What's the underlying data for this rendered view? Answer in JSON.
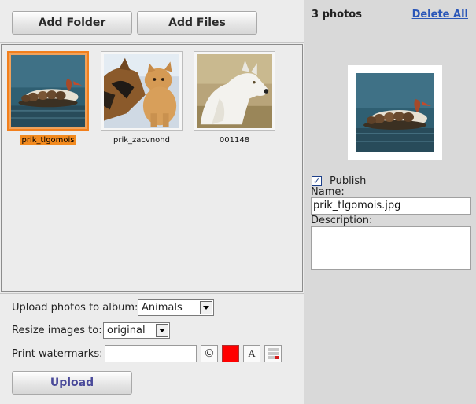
{
  "toolbar": {
    "add_folder_label": "Add Folder",
    "add_files_label": "Add Files"
  },
  "gallery": {
    "items": [
      {
        "caption": "prik_tlgomois",
        "selected": true,
        "image": "ducks-on-water"
      },
      {
        "caption": "prik_zacvnohd",
        "selected": false,
        "image": "dog-and-cat"
      },
      {
        "caption": "001148",
        "selected": false,
        "image": "white-wolf"
      }
    ],
    "selection_color": "#f27f1c"
  },
  "options": {
    "album_label": "Upload photos to album:",
    "album_value": "Animals",
    "resize_label": "Resize images to:",
    "resize_value": "original",
    "watermark_label": "Print watermarks:",
    "watermark_value": "",
    "watermark_color": "#ff0000",
    "watermark_icons": [
      "copyright-icon",
      "color-swatch",
      "text-style-icon",
      "position-grid-icon"
    ]
  },
  "upload_label": "Upload",
  "sidebar": {
    "count_text": "3 photos",
    "delete_all_label": "Delete All",
    "preview_image": "ducks-on-water",
    "publish_label": "Publish",
    "publish_checked": true,
    "name_label": "Name:",
    "name_value": "prik_tlgomois.jpg",
    "description_label": "Description:",
    "description_value": ""
  }
}
